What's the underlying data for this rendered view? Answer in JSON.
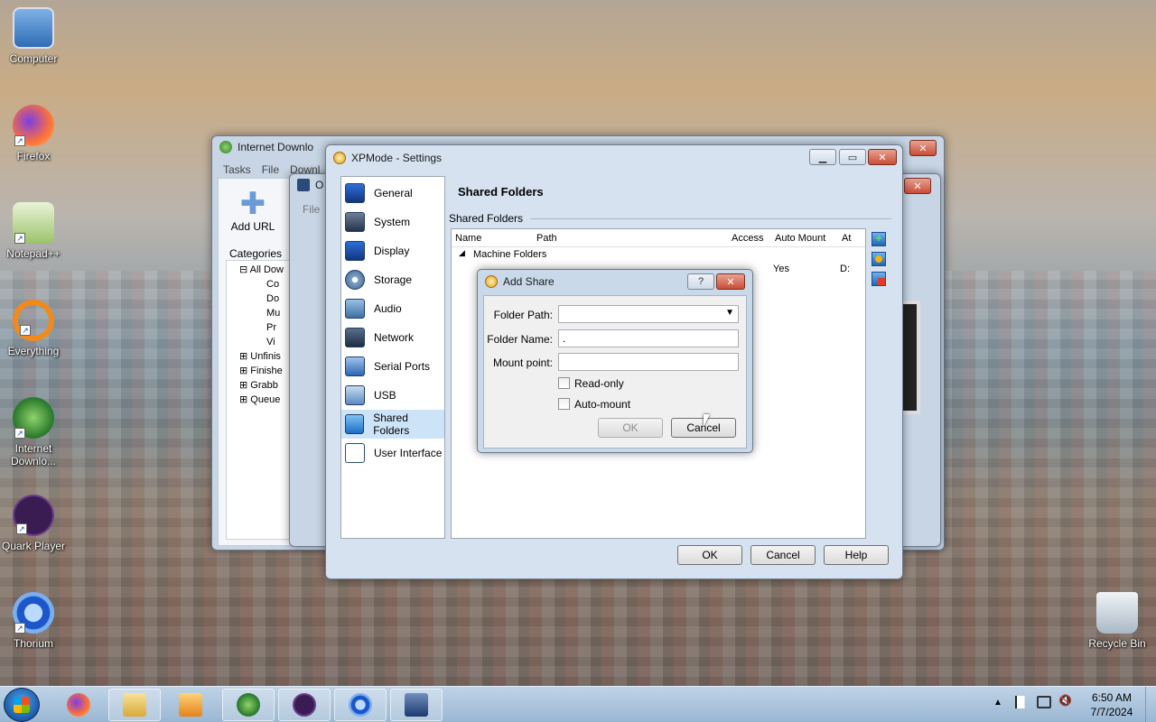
{
  "desktop": {
    "icons": [
      {
        "label": "Computer"
      },
      {
        "label": "Firefox"
      },
      {
        "label": "Notepad++"
      },
      {
        "label": "Everything"
      },
      {
        "label": "Internet Downlo..."
      },
      {
        "label": "Quark Player"
      },
      {
        "label": "Thorium"
      },
      {
        "label": "Recycle Bin"
      }
    ]
  },
  "idm_window": {
    "title": "Internet Downlo",
    "menu": [
      "Tasks",
      "File",
      "Downl"
    ],
    "add_url": "Add URL",
    "categories_label": "Categories",
    "tree": [
      "All Dow",
      "Co",
      "Do",
      "Mu",
      "Pr",
      "Vi",
      "Unfinis",
      "Finishe",
      "Grabb",
      "Queue"
    ]
  },
  "vbox_window": {
    "title": "O",
    "menu_file": "File"
  },
  "settings": {
    "title": "XPMode - Settings",
    "nav": [
      {
        "label": "General",
        "icon": "general-icon"
      },
      {
        "label": "System",
        "icon": "system-icon"
      },
      {
        "label": "Display",
        "icon": "display-icon"
      },
      {
        "label": "Storage",
        "icon": "storage-icon"
      },
      {
        "label": "Audio",
        "icon": "audio-icon"
      },
      {
        "label": "Network",
        "icon": "network-icon"
      },
      {
        "label": "Serial Ports",
        "icon": "serial-ports-icon"
      },
      {
        "label": "USB",
        "icon": "usb-icon"
      },
      {
        "label": "Shared Folders",
        "icon": "shared-folders-icon"
      },
      {
        "label": "User Interface",
        "icon": "user-interface-icon"
      }
    ],
    "page_title": "Shared Folders",
    "group_label": "Shared Folders",
    "table": {
      "columns": [
        "Name",
        "Path",
        "Access",
        "Auto Mount",
        "At"
      ],
      "group": "Machine Folders",
      "row": {
        "auto_mount": "Yes",
        "at": "D:"
      }
    },
    "buttons": {
      "ok": "OK",
      "cancel": "Cancel",
      "help": "Help"
    }
  },
  "add_share": {
    "title": "Add Share",
    "help_glyph": "?",
    "folder_path_label": "Folder Path:",
    "folder_name_label": "Folder Name:",
    "folder_name_value": ".",
    "mount_point_label": "Mount point:",
    "readonly_label": "Read-only",
    "automount_label": "Auto-mount",
    "ok": "OK",
    "cancel": "Cancel"
  },
  "taskbar": {
    "time": "6:50 AM",
    "date": "7/7/2024",
    "apps": [
      "firefox-icon",
      "explorer-icon",
      "media-icon",
      "idm-icon",
      "quark-icon",
      "thorium-icon",
      "virtualbox-icon"
    ]
  }
}
